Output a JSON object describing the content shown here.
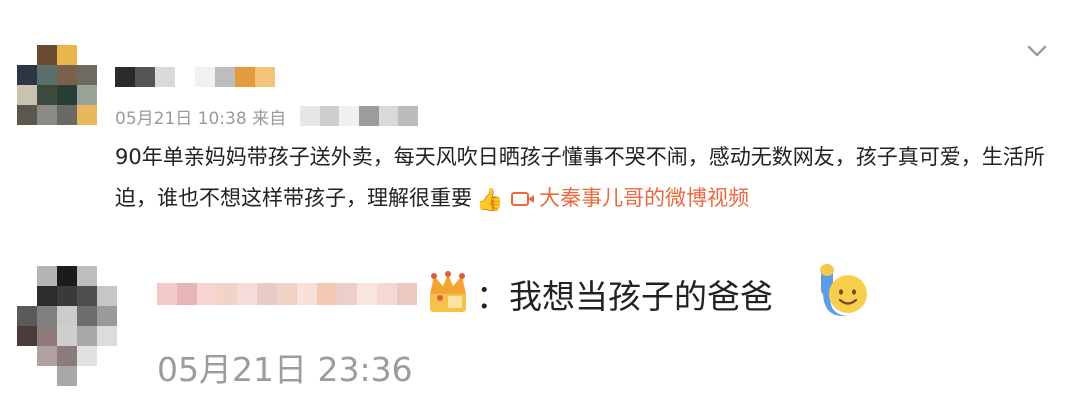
{
  "post": {
    "avatar_tiles": [
      "#ffffff",
      "#6b4a34",
      "#e8b64a",
      "#ffffff",
      "#2e3545",
      "#5b6f6a",
      "#7b604b",
      "#6f6a5f",
      "#c9c2b0",
      "#3b4a3c",
      "#283e34",
      "#9aa39a",
      "#5a574e",
      "#8c8a86",
      "#6a6968",
      "#e9b85d"
    ],
    "username_tiles": [
      "#2b2b2b",
      "#555555",
      "#d9d9d9",
      "#ffffff",
      "#f1f1f1",
      "#bdbdbd",
      "#e69a3e",
      "#f5c37a"
    ],
    "date": "05月21日",
    "time": "10:38",
    "source_prefix": "来自",
    "source_blur_tiles": [
      "#e6e6e6",
      "#cfcfcf",
      "#f0f0f0",
      "#9c9c9c",
      "#d9d9d9",
      "#bcbcbc"
    ],
    "text": "90年单亲妈妈带孩子送外卖，每天风吹日晒孩子懂事不哭不闹，感动无数网友，孩子真可爱，生活所迫，谁也不想这样带孩子，理解很重要",
    "thumb_emoji": "👍",
    "video_link": "大秦事儿哥的微博视频"
  },
  "reply": {
    "avatar_tiles": [
      "#ffffff",
      "#b5b5b5",
      "#1b1b1b",
      "#bdbdbd",
      "#ffffff",
      "#ffffff",
      "#2c2c2c",
      "#3a3a3a",
      "#4e4e4e",
      "#c6c6c6",
      "#5a5a5a",
      "#7f7f7f",
      "#cccccc",
      "#6d6d6d",
      "#9a9a9a",
      "#4a3a3a",
      "#8f7a7a",
      "#cfcfcf",
      "#a9a9a9",
      "#dcdcdc",
      "#ffffff",
      "#b0a0a0",
      "#8b7b7b",
      "#e2e2e2",
      "#ffffff",
      "#ffffff",
      "#ffffff",
      "#a8a8a8",
      "#ffffff",
      "#ffffff"
    ],
    "username_tiles": [
      "#f2c8c8",
      "#e7b5b5",
      "#f7d6d2",
      "#f1d3c8",
      "#f4dcd8",
      "#e8cbc6",
      "#f0d2c5",
      "#f7e1d8",
      "#f4c9b3",
      "#ebd0c9",
      "#f9e6df",
      "#f4d8d2",
      "#ecc8c2"
    ],
    "crown_emoji": "👑",
    "text": "：我想当孩子的爸爸",
    "wave_emoji": "🙋",
    "timestamp": "05月21日 23:36"
  }
}
